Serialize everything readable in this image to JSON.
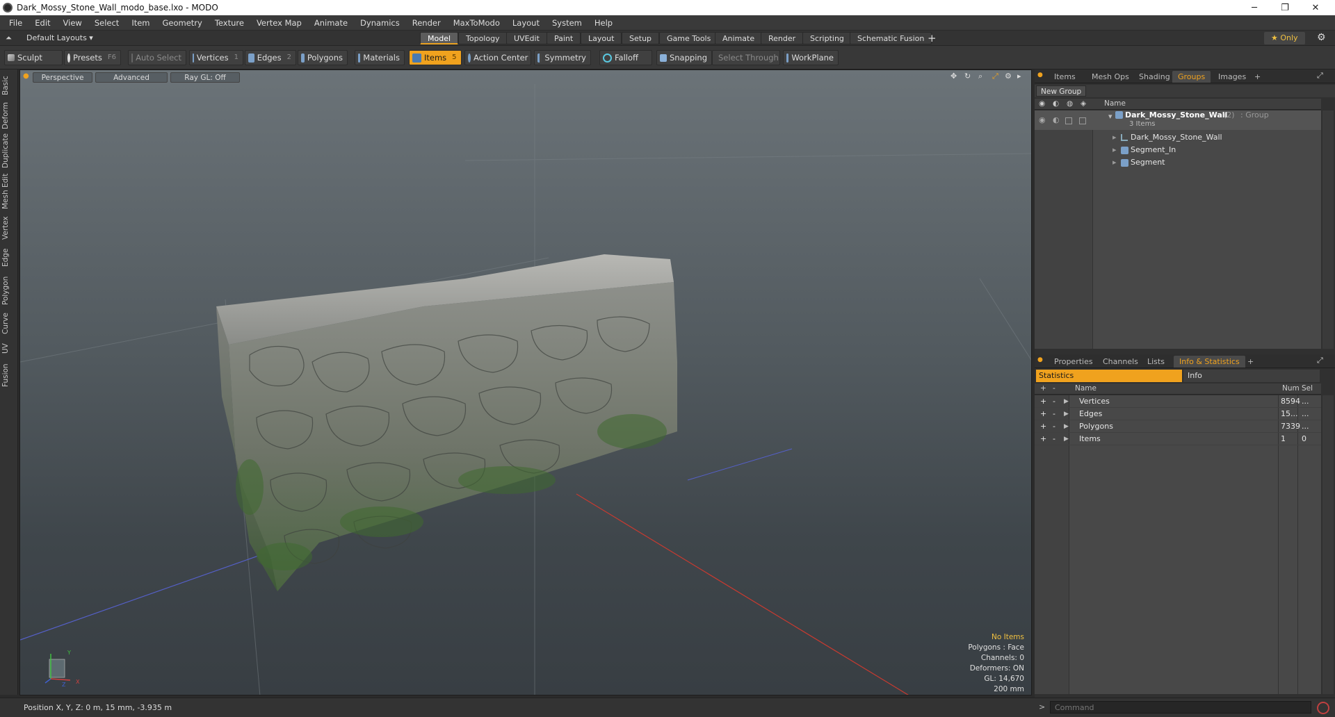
{
  "window": {
    "title": "Dark_Mossy_Stone_Wall_modo_base.lxo - MODO",
    "min": "─",
    "max": "❐",
    "close": "✕"
  },
  "menubar": [
    "File",
    "Edit",
    "View",
    "Select",
    "Item",
    "Geometry",
    "Texture",
    "Vertex Map",
    "Animate",
    "Dynamics",
    "Render",
    "MaxToModo",
    "Layout",
    "System",
    "Help"
  ],
  "layoutbar": {
    "layouts_label": "Default Layouts ▾",
    "tabs": [
      "Model",
      "Topology",
      "UVEdit",
      "Paint",
      "Layout",
      "Setup",
      "Game Tools",
      "Animate",
      "Render",
      "Scripting",
      "Schematic Fusion"
    ],
    "active_tab": "Model",
    "add": "+",
    "only_label": "★  Only",
    "gear": "⚙"
  },
  "toolbar": {
    "sculpt": "Sculpt",
    "presets": "Presets",
    "presets_key": "F6",
    "auto_select": "Auto Select",
    "vertices": "Vertices",
    "vertices_key": "1",
    "edges": "Edges",
    "edges_key": "2",
    "polygons": "Polygons",
    "materials": "Materials",
    "items": "Items",
    "items_key": "5",
    "action_center": "Action Center",
    "symmetry": "Symmetry",
    "falloff": "Falloff",
    "snapping": "Snapping",
    "select_through": "Select Through",
    "workplane": "WorkPlane"
  },
  "lefttabs": [
    "Basic",
    "Deform",
    "Duplicate",
    "Mesh Edit",
    "Vertex",
    "Edge",
    "Polygon",
    "Curve",
    "UV",
    "Fusion"
  ],
  "viewport": {
    "perspective": "Perspective",
    "advanced": "Advanced",
    "raygl": "Ray GL: Off",
    "info": {
      "no_items": "No Items",
      "polygons": "Polygons : Face",
      "channels": "Channels: 0",
      "deformers": "Deformers: ON",
      "gl": "GL: 14,670",
      "scale": "200 mm"
    },
    "axis": {
      "y": "Y",
      "x": "X",
      "z": "Z"
    }
  },
  "groups_panel": {
    "tabs": [
      "Items",
      "Mesh Ops",
      "Shading",
      "Groups",
      "Images"
    ],
    "active_tab": "Groups",
    "add": "+",
    "new_group": "New Group",
    "col_name": "Name",
    "group_name": "Dark_Mossy_Stone_Wall",
    "group_count": "(2)",
    "group_type": ": Group",
    "group_items": "3 Items",
    "children": [
      "Dark_Mossy_Stone_Wall",
      "Segment_In",
      "Segment"
    ]
  },
  "stats_panel": {
    "tabs": [
      "Properties",
      "Channels",
      "Lists",
      "Info & Statistics"
    ],
    "active_tab": "Info & Statistics",
    "add": "+",
    "sub_tabs": [
      "Statistics",
      "Info"
    ],
    "col_name": "Name",
    "col_num": "Num",
    "col_sel": "Sel",
    "rows": [
      {
        "name": "Vertices",
        "num": "8594",
        "sel": "..."
      },
      {
        "name": "Edges",
        "num": "15...",
        "sel": "..."
      },
      {
        "name": "Polygons",
        "num": "7339",
        "sel": "..."
      },
      {
        "name": "Items",
        "num": "1",
        "sel": "0"
      }
    ]
  },
  "statusbar": {
    "position": "Position X, Y, Z:   0 m, 15 mm, -3.935 m"
  },
  "command": {
    "placeholder": "Command"
  },
  "colors": {
    "accent": "#f0a21e",
    "menubar": "#3a3a3a",
    "panel": "#484848"
  }
}
